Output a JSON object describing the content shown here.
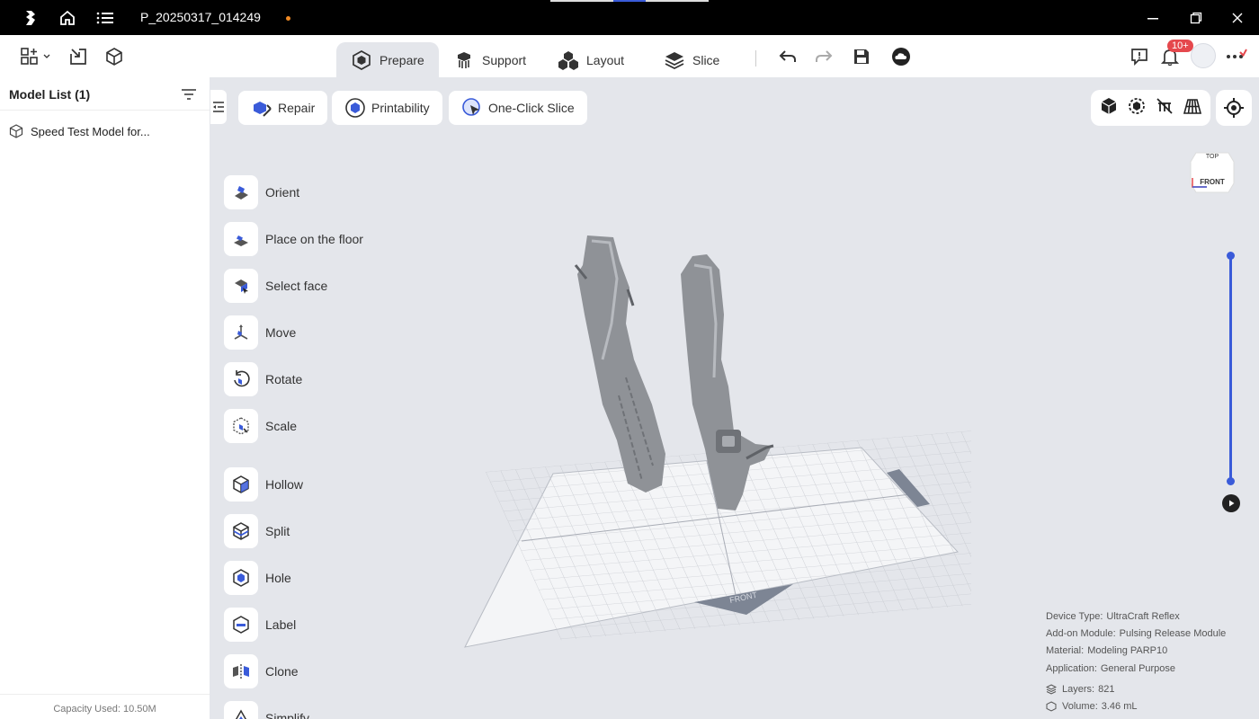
{
  "titlebar": {
    "project_name": "P_20250317_014249",
    "unsaved_dot_color": "#f08a24"
  },
  "toolbar": {
    "tabs": [
      {
        "label": "Prepare",
        "icon": "prepare-icon",
        "active": true
      },
      {
        "label": "Support",
        "icon": "support-icon",
        "active": false
      },
      {
        "label": "Layout",
        "icon": "layout-icon",
        "active": false
      },
      {
        "label": "Slice",
        "icon": "slice-icon",
        "active": false
      }
    ],
    "notification_badge": "10+"
  },
  "left_panel": {
    "title": "Model List (1)",
    "items": [
      {
        "label": "Speed Test Model for..."
      }
    ],
    "footer": "Capacity Used: 10.50M"
  },
  "actions": {
    "repair": "Repair",
    "printability": "Printability",
    "one_click_slice": "One-Click Slice"
  },
  "tools": {
    "orient": "Orient",
    "place_on_floor": "Place on the floor",
    "select_face": "Select face",
    "move": "Move",
    "rotate": "Rotate",
    "scale": "Scale",
    "hollow": "Hollow",
    "split": "Split",
    "hole": "Hole",
    "label": "Label",
    "clone": "Clone",
    "simplify": "Simplify"
  },
  "viewcube": {
    "top": "TOP",
    "front": "FRONT"
  },
  "plate": {
    "front_label": "FRONT"
  },
  "info": {
    "device_type_label": "Device Type:",
    "device_type": "UltraCraft Reflex",
    "addon_label": "Add-on Module:",
    "addon": "Pulsing Release Module",
    "material_label": "Material:",
    "material": "Modeling PARP10",
    "application_label": "Application:",
    "application": "General Purpose",
    "layers_label": "Layers:",
    "layers": "821",
    "volume_label": "Volume:",
    "volume": "3.46 mL"
  },
  "colors": {
    "accent": "#3a5bd9",
    "badge": "#e5484d"
  }
}
